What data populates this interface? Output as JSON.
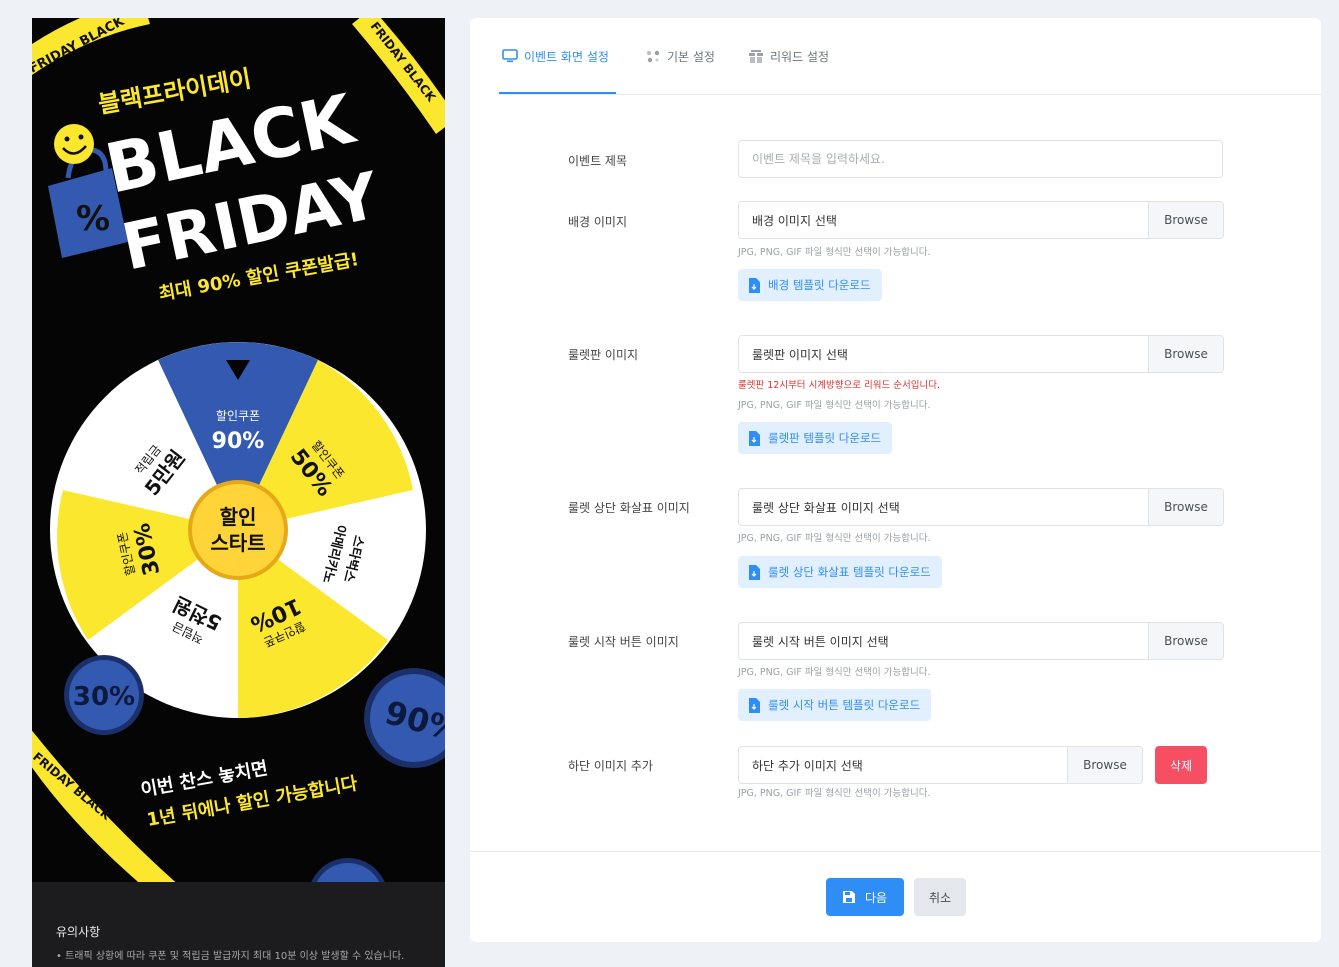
{
  "preview": {
    "title_kr": "블랙프라이데이",
    "title_line1": "BLACK",
    "title_line2": "FRIDAY",
    "subtitle": "최대 90% 할인 쿠폰발급!",
    "banner_text": "FRIDAY BLACK",
    "percent_symbol": "%",
    "wheel_segments": [
      {
        "line1": "할인쿠폰",
        "line2": "90%"
      },
      {
        "line1": "할인쿠폰",
        "line2": "50%"
      },
      {
        "line1": "스타벅스",
        "line2": "아메리카노"
      },
      {
        "line1": "할인쿠폰",
        "line2": "10%"
      },
      {
        "line1": "적립금",
        "line2": "5천원"
      },
      {
        "line1": "할인쿠폰",
        "line2": "30%"
      },
      {
        "line1": "적립금",
        "line2": "5만원"
      }
    ],
    "center_line1": "할인",
    "center_line2": "스타트",
    "coin_left": "30%",
    "coin_right": "90%",
    "bottom_line1": "이번 찬스 놓치면",
    "bottom_line2": "1년 뒤에나 할인 가능합니다",
    "notice_title": "유의사항",
    "notice_text": "• 트래픽 상황에 따라 쿠폰 및 적립금 발급까지 최대 10분 이상 발생할 수 있습니다."
  },
  "tabs": [
    {
      "label": "이벤트 화면 설정",
      "icon": "monitor-icon",
      "active": true
    },
    {
      "label": "기본 설정",
      "icon": "settings-dots-icon",
      "active": false
    },
    {
      "label": "리워드 설정",
      "icon": "gift-icon",
      "active": false
    }
  ],
  "form": {
    "title": {
      "label": "이벤트 제목",
      "placeholder": "이벤트 제목을 입력하세요.",
      "value": ""
    },
    "background": {
      "label": "배경 이미지",
      "file_text": "배경 이미지 선택",
      "browse": "Browse",
      "help": "JPG, PNG, GIF 파일 형식만 선택이 가능합니다.",
      "download": "배경 템플릿 다운로드"
    },
    "roulette": {
      "label": "룰렛판 이미지",
      "file_text": "룰렛판 이미지 선택",
      "browse": "Browse",
      "warning": "룰렛판 12시부터 시계방향으로 리워드 순서입니다.",
      "help": "JPG, PNG, GIF 파일 형식만 선택이 가능합니다.",
      "download": "룰렛판 템플릿 다운로드"
    },
    "arrow": {
      "label": "룰렛 상단 화살표 이미지",
      "file_text": "룰렛 상단 화살표 이미지 선택",
      "browse": "Browse",
      "help": "JPG, PNG, GIF 파일 형식만 선택이 가능합니다.",
      "download": "룰렛 상단 화살표 템플릿 다운로드"
    },
    "start_button": {
      "label": "룰렛 시작 버튼 이미지",
      "file_text": "룰렛 시작 버튼 이미지 선택",
      "browse": "Browse",
      "help": "JPG, PNG, GIF 파일 형식만 선택이 가능합니다.",
      "download": "룰렛 시작 버튼 템플릿 다운로드"
    },
    "bottom": {
      "label": "하단 이미지 추가",
      "file_text": "하단 추가 이미지 선택",
      "browse": "Browse",
      "help": "JPG, PNG, GIF 파일 형식만 선택이 가능합니다.",
      "delete": "삭제"
    }
  },
  "footer": {
    "next": "다음",
    "cancel": "취소"
  },
  "colors": {
    "accent": "#2f8ef5",
    "danger": "#f64f64",
    "wheel_yellow": "#fbe72e",
    "wheel_blue": "#3459b0",
    "page_bg": "#eef2f7"
  }
}
